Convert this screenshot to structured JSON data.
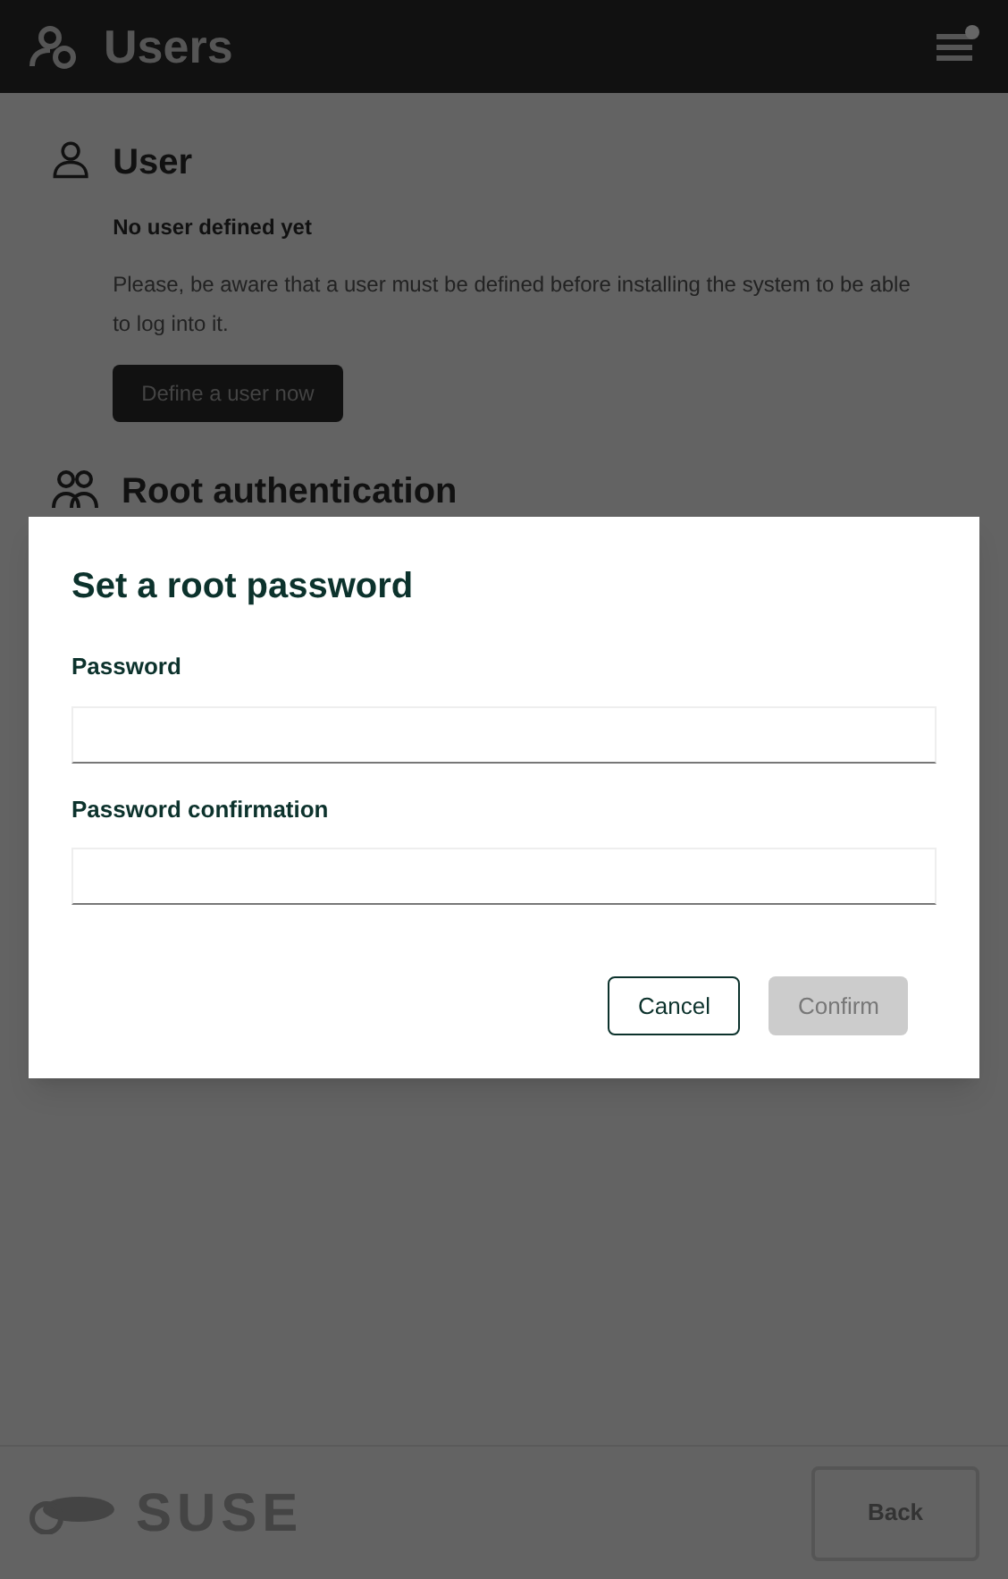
{
  "header": {
    "title": "Users"
  },
  "sections": [
    {
      "kind": "user",
      "title": "User",
      "status": "No user defined yet",
      "note": "Please, be aware that a user must be defined before installing the system to be able to log into it.",
      "action": "Define a user now"
    },
    {
      "kind": "root",
      "title": "Root authentication"
    }
  ],
  "dialog": {
    "title": "Set a root password",
    "fields": [
      {
        "label": "Password"
      },
      {
        "label": "Password confirmation"
      }
    ],
    "buttons": [
      {
        "label": "Cancel",
        "disabled": false
      },
      {
        "label": "Confirm",
        "disabled": true
      }
    ]
  },
  "footer": {
    "logo": "SUSE",
    "back": "Back"
  }
}
